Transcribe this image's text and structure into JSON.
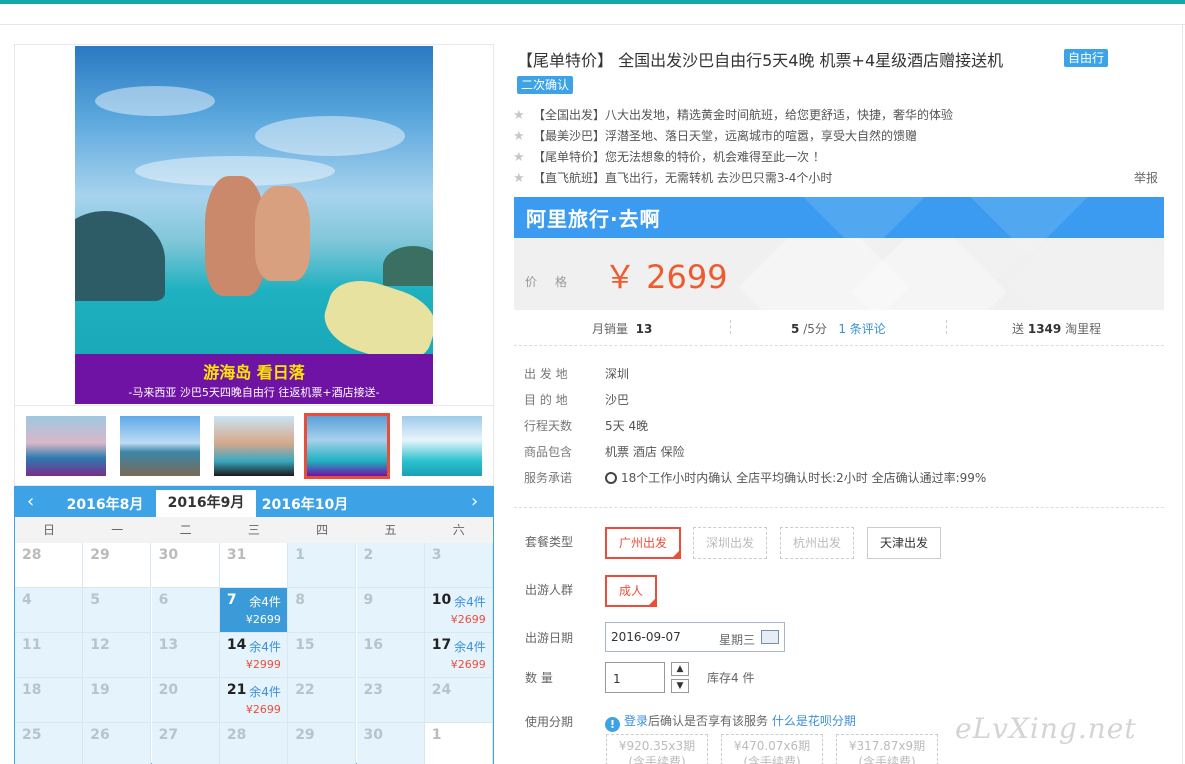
{
  "product": {
    "title": "【尾单特价】 全国出发沙巴自由行5天4晚 机票+4星级酒店赠接送机",
    "tags": [
      "自由行",
      "二次确认"
    ],
    "features": [
      "【全国出发】八大出发地，精选黄金时间航班，给您更舒适，快捷，奢华的体验",
      "【最美沙巴】浮潜圣地、落日天堂，远离城市的喧嚣，享受大自然的馈赠",
      "【尾单特价】您无法想象的特价，机会难得至此一次 ！",
      "【直飞航班】直飞出行，无需转机 去沙巴只需3-4个小时"
    ],
    "report": "举报"
  },
  "gallery": {
    "banner_title": "游海岛  看日落",
    "banner_sub": "-马来西亚 沙巴5天四晚自由行 往返机票+酒店接送-",
    "thumbs": [
      "thumb-1",
      "thumb-2",
      "thumb-3",
      "thumb-4",
      "thumb-5"
    ],
    "selected_thumb": 4
  },
  "price": {
    "brand": "阿里旅行·去啊",
    "label": "价格",
    "value": "￥ 2699"
  },
  "stats": {
    "sales_label": "月销量",
    "sales": "13",
    "rating": "5",
    "rating_suffix": "/5分",
    "reviews": "1 条评论",
    "points_prefix": "送",
    "points": "1349",
    "points_suffix": "淘里程"
  },
  "props": [
    {
      "k": "出 发 地",
      "v": "深圳"
    },
    {
      "k": "目 的 地",
      "v": "沙巴"
    },
    {
      "k": "行程天数",
      "v": "5天 4晚"
    },
    {
      "k": "商品包含",
      "v": "机票   酒店   保险"
    },
    {
      "k": "服务承诺",
      "v": "18个工作小时内确认     全店平均确认时长:2小时     全店确认通过率:99%"
    }
  ],
  "options": {
    "package_label": "套餐类型",
    "packages": [
      "广州出发",
      "深圳出发",
      "杭州出发",
      "天津出发"
    ],
    "crowd_label": "出游人群",
    "crowd": "成人",
    "date_label": "出游日期",
    "date": "2016-09-07",
    "weekday": "星期三",
    "qty_label": "数    量",
    "qty": "1",
    "stock": "库存4 件",
    "install_label": "使用分期",
    "install_info_link": "登录",
    "install_info": "后确认是否享有该服务",
    "install_what": "什么是花呗分期",
    "installments": [
      {
        "a": "¥920.35x3期",
        "b": "(含手续费)"
      },
      {
        "a": "¥470.07x6期",
        "b": "(含手续费)"
      },
      {
        "a": "¥317.87x9期",
        "b": "(含手续费)"
      }
    ]
  },
  "calendar": {
    "months": [
      "2016年8月",
      "2016年9月",
      "2016年10月"
    ],
    "active_month": 1,
    "weekdays": [
      "日",
      "一",
      "二",
      "三",
      "四",
      "五",
      "六"
    ],
    "weeks": [
      [
        {
          "d": "28",
          "out": true
        },
        {
          "d": "29",
          "out": true
        },
        {
          "d": "30",
          "out": true
        },
        {
          "d": "31",
          "out": true
        },
        {
          "d": "1"
        },
        {
          "d": "2"
        },
        {
          "d": "3"
        }
      ],
      [
        {
          "d": "4"
        },
        {
          "d": "5"
        },
        {
          "d": "6"
        },
        {
          "d": "7",
          "st": "余4件",
          "pr": "¥2699",
          "sel": true
        },
        {
          "d": "8"
        },
        {
          "d": "9"
        },
        {
          "d": "10",
          "st": "余4件",
          "pr": "¥2699"
        }
      ],
      [
        {
          "d": "11"
        },
        {
          "d": "12"
        },
        {
          "d": "13"
        },
        {
          "d": "14",
          "st": "余4件",
          "pr": "¥2999"
        },
        {
          "d": "15"
        },
        {
          "d": "16"
        },
        {
          "d": "17",
          "st": "余4件",
          "pr": "¥2699"
        }
      ],
      [
        {
          "d": "18"
        },
        {
          "d": "19"
        },
        {
          "d": "20"
        },
        {
          "d": "21",
          "st": "余4件",
          "pr": "¥2699"
        },
        {
          "d": "22"
        },
        {
          "d": "23"
        },
        {
          "d": "24"
        }
      ],
      [
        {
          "d": "25"
        },
        {
          "d": "26"
        },
        {
          "d": "27"
        },
        {
          "d": "28"
        },
        {
          "d": "29"
        },
        {
          "d": "30"
        },
        {
          "d": "1",
          "out": true
        }
      ]
    ]
  },
  "watermark": "eLvXing.net",
  "colors": {
    "accent": "#3da3e6",
    "price": "#f05a2f",
    "selected": "#e94e3d",
    "topbar": "#13a8a8"
  }
}
